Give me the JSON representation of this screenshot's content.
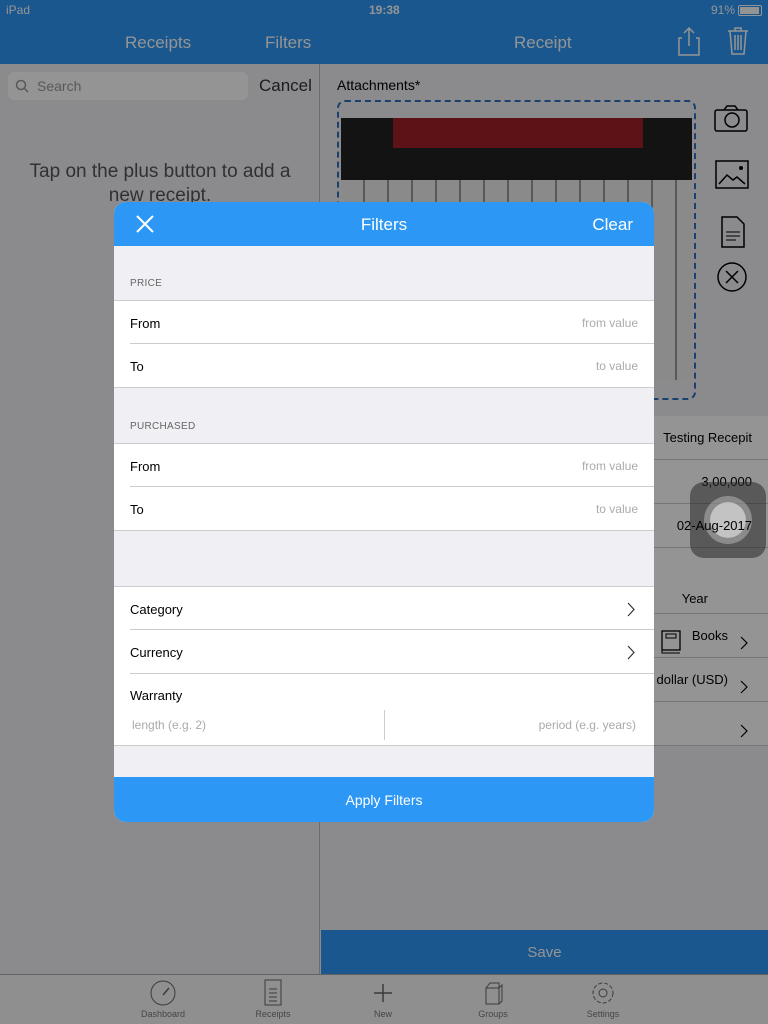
{
  "status_bar": {
    "device": "iPad",
    "time": "19:38",
    "battery": "91%"
  },
  "left_pane": {
    "title": "Receipts",
    "filters_label": "Filters",
    "search_placeholder": "Search",
    "cancel_label": "Cancel",
    "empty_message": "Tap on the plus button to add a new receipt."
  },
  "right_pane": {
    "title": "Receipt",
    "attachments_label": "Attachments*",
    "name_value": "Testing  Recepit",
    "price_value": "3,00,000",
    "date_value": "02-Aug-2017",
    "warranty_period": "Year",
    "category_value": "Books",
    "currency_value": "dollar (USD)",
    "save_label": "Save"
  },
  "tab_bar": {
    "items": [
      {
        "label": "Dashboard",
        "icon": "gauge-icon"
      },
      {
        "label": "Receipts",
        "icon": "list-icon"
      },
      {
        "label": "New",
        "icon": "plus-icon"
      },
      {
        "label": "Groups",
        "icon": "box-icon"
      },
      {
        "label": "Settings",
        "icon": "gear-icon"
      }
    ]
  },
  "modal": {
    "title": "Filters",
    "clear_label": "Clear",
    "price": {
      "section": "PRICE",
      "from_label": "From",
      "from_placeholder": "from value",
      "to_label": "To",
      "to_placeholder": "to value"
    },
    "purchased": {
      "section": "PURCHASED",
      "from_label": "From",
      "from_placeholder": "from value",
      "to_label": "To",
      "to_placeholder": "to value"
    },
    "category_label": "Category",
    "currency_label": "Currency",
    "warranty_label": "Warranty",
    "length_placeholder": "length (e.g. 2)",
    "period_placeholder": "period (e.g. years)",
    "apply_label": "Apply Filters"
  },
  "colors": {
    "accent": "#2c97f5"
  }
}
